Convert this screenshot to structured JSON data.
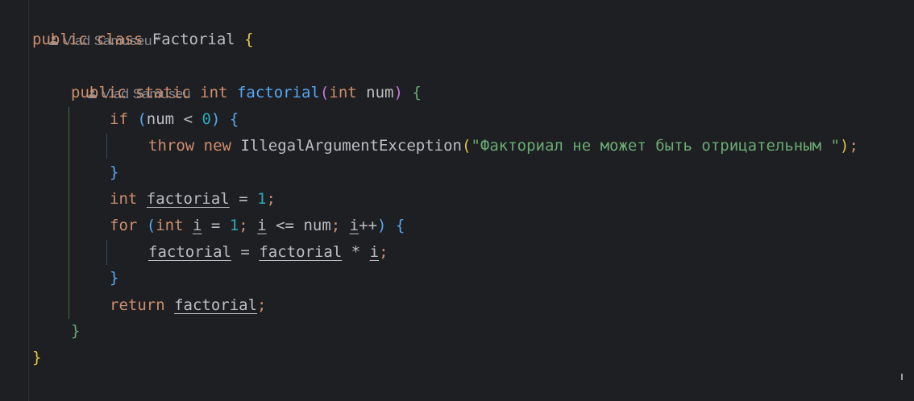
{
  "editor": {
    "author_hint_class": "Vlad Samuseu *",
    "author_hint_method": "Vlad Samuseu",
    "icon": "person-icon",
    "lines": {
      "l1": {
        "kw1": "public",
        "kw2": "class",
        "name": "Factorial",
        "brace": "{"
      },
      "l2": {
        "kw1": "public",
        "kw2": "static",
        "kw3": "int",
        "fn": "factorial",
        "open": "(",
        "ptype": "int",
        "pname": "num",
        "close": ")",
        "brace": "{"
      },
      "l3": {
        "kw": "if",
        "open": "(",
        "var": "num",
        "op": "<",
        "num": "0",
        "close": ")",
        "brace": "{"
      },
      "l4": {
        "kw1": "throw",
        "kw2": "new",
        "cls": "IllegalArgumentException",
        "open": "(",
        "str": "\"Факториал не может быть отрицательным \"",
        "close": ")",
        "semi": ";"
      },
      "l5": {
        "brace": "}"
      },
      "l6": {
        "kw": "int",
        "var": "factorial",
        "op": "=",
        "num": "1",
        "semi": ";"
      },
      "l7": {
        "kw": "for",
        "open": "(",
        "kw2": "int",
        "var1": "i",
        "op1": "=",
        "num": "1",
        "semi1": ";",
        "var2": "i",
        "op2": "<=",
        "var3": "num",
        "semi2": ";",
        "var4": "i",
        "op3": "++",
        "close": ")",
        "brace": "{"
      },
      "l8": {
        "var1": "factorial",
        "op1": "=",
        "var2": "factorial",
        "op2": "*",
        "var3": "i",
        "semi": ";"
      },
      "l9": {
        "brace": "}"
      },
      "l10": {
        "kw": "return",
        "var": "factorial",
        "semi": ";"
      },
      "l11": {
        "brace": "}"
      },
      "l12": {
        "brace": "}"
      }
    }
  }
}
